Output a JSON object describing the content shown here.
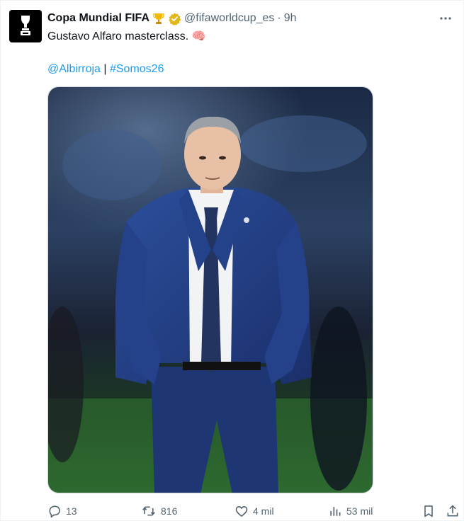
{
  "account": {
    "display_name": "Copa Mundial FIFA",
    "handle": "@fifaworldcup_es",
    "separator": "·",
    "time": "9h"
  },
  "tweet": {
    "text": "Gustavo Alfaro masterclass. 🧠",
    "tag_albirroja": "@Albirroja",
    "tag_sep": " | ",
    "tag_somos26": "#Somos26"
  },
  "stats": {
    "replies": "13",
    "retweets": "816",
    "likes": "4 mil",
    "views": "53 mil"
  },
  "icons": {
    "avatar": "fifa-world-cup-trophy-logo",
    "badge": "gold-verified-badge",
    "emoji": "trophy-emoji",
    "more": "more-icon",
    "reply": "reply-icon",
    "retweet": "retweet-icon",
    "like": "heart-icon",
    "views": "views-icon",
    "bookmark": "bookmark-icon",
    "share": "share-icon"
  },
  "colors": {
    "link": "#1d9bf0",
    "secondary_text": "#536471",
    "verified_gold": "#e2b719"
  }
}
